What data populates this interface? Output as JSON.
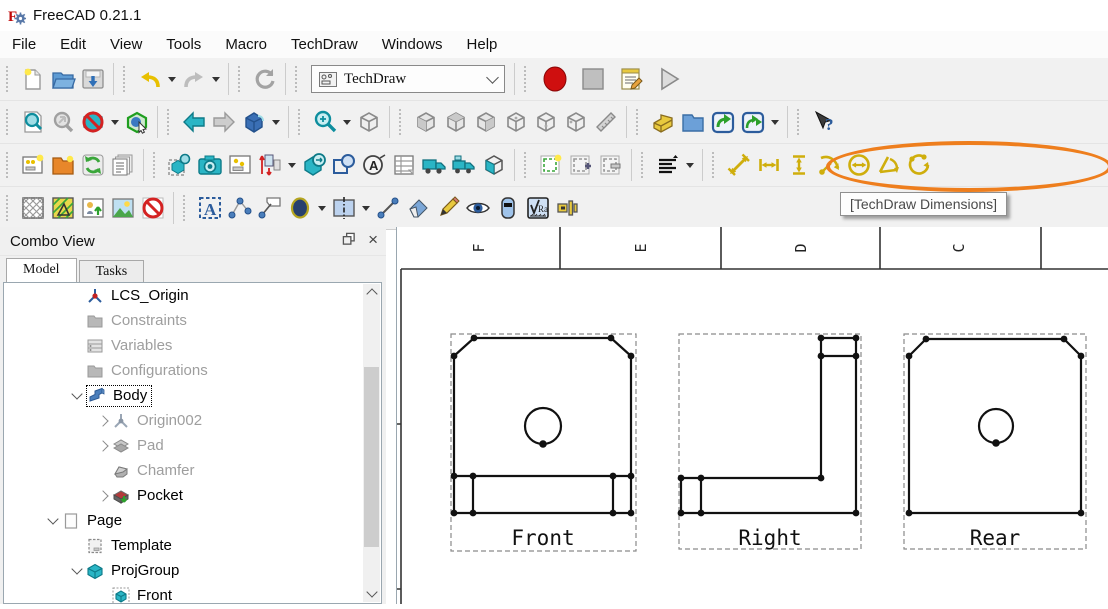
{
  "window": {
    "title": "FreeCAD 0.21.1"
  },
  "menus": [
    "File",
    "Edit",
    "View",
    "Tools",
    "Macro",
    "TechDraw",
    "Windows",
    "Help"
  ],
  "workbench": {
    "selected": "TechDraw"
  },
  "tooltip": {
    "text": "[TechDraw Dimensions]"
  },
  "combo_view": {
    "title": "Combo View",
    "tabs": [
      "Model",
      "Tasks"
    ],
    "tree": [
      {
        "label": "LCS_Origin"
      },
      {
        "label": "Constraints"
      },
      {
        "label": "Variables"
      },
      {
        "label": "Configurations"
      },
      {
        "label": "Body"
      },
      {
        "label": "Origin002"
      },
      {
        "label": "Pad"
      },
      {
        "label": "Chamfer"
      },
      {
        "label": "Pocket"
      },
      {
        "label": "Page"
      },
      {
        "label": "Template"
      },
      {
        "label": "ProjGroup"
      },
      {
        "label": "Front"
      }
    ]
  },
  "drawing": {
    "zone_labels": [
      "F",
      "E",
      "D",
      "C"
    ],
    "views": [
      {
        "label": "Front"
      },
      {
        "label": "Right"
      },
      {
        "label": "Rear"
      }
    ]
  },
  "colors": {
    "highlight": "#ee7e1d",
    "teal": "#2ab5c5",
    "record_red": "#cf0f0f"
  }
}
